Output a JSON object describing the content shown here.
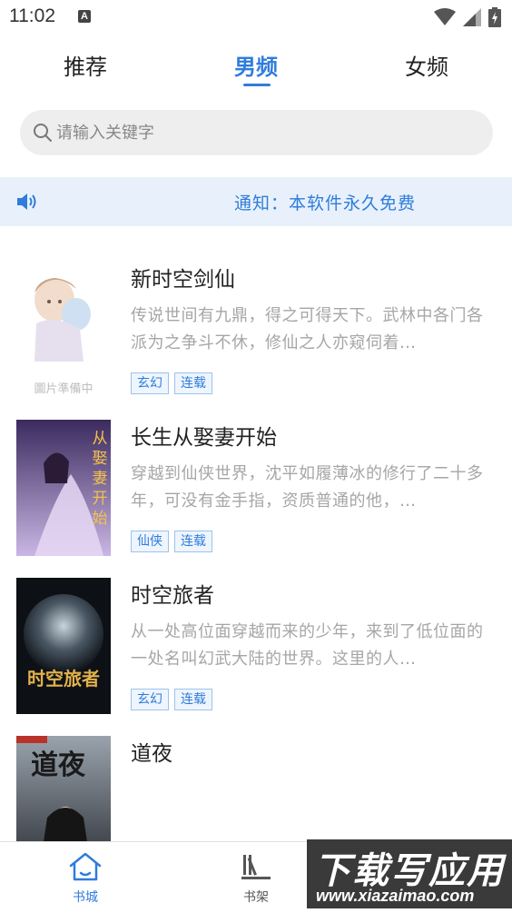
{
  "status_bar": {
    "time": "11:02",
    "notification_icon": "a-icon"
  },
  "tabs": [
    {
      "label": "推荐",
      "active": false
    },
    {
      "label": "男频",
      "active": true
    },
    {
      "label": "女频",
      "active": false
    }
  ],
  "search": {
    "placeholder": "请输入关键字",
    "value": ""
  },
  "notice": {
    "icon": "speaker-icon",
    "text": "通知：本软件永久免费"
  },
  "books": [
    {
      "title": "新时空剑仙",
      "desc": "传说世间有九鼎，得之可得天下。武林中各门各派为之争斗不休，修仙之人亦窥伺着…",
      "tags": [
        "玄幻",
        "连载"
      ],
      "cover_caption": "圖片準備中"
    },
    {
      "title": "长生从娶妻开始",
      "desc": "穿越到仙侠世界，沈平如履薄冰的修行了二十多年，可没有金手指，资质普通的他，…",
      "tags": [
        "仙侠",
        "连载"
      ],
      "cover_text": "从娶妻开始"
    },
    {
      "title": "时空旅者",
      "desc": "从一处高位面穿越而来的少年，来到了低位面的一处名叫幻武大陆的世界。这里的人…",
      "tags": [
        "玄幻",
        "连载"
      ],
      "cover_text": "时空旅者"
    },
    {
      "title": "道夜",
      "desc": "",
      "tags": [],
      "cover_text": "道夜"
    }
  ],
  "bottom_nav": [
    {
      "label": "书城",
      "icon": "home-icon",
      "active": true
    },
    {
      "label": "书架",
      "icon": "bookshelf-icon",
      "active": false
    }
  ],
  "watermark": {
    "main": "下载写应用",
    "url": "www.xiazaimao.com"
  },
  "colors": {
    "accent": "#2f7cdb",
    "notice_bg": "#e8f1fb",
    "search_bg": "#eeeeee",
    "desc_text": "#a6a6a6"
  }
}
